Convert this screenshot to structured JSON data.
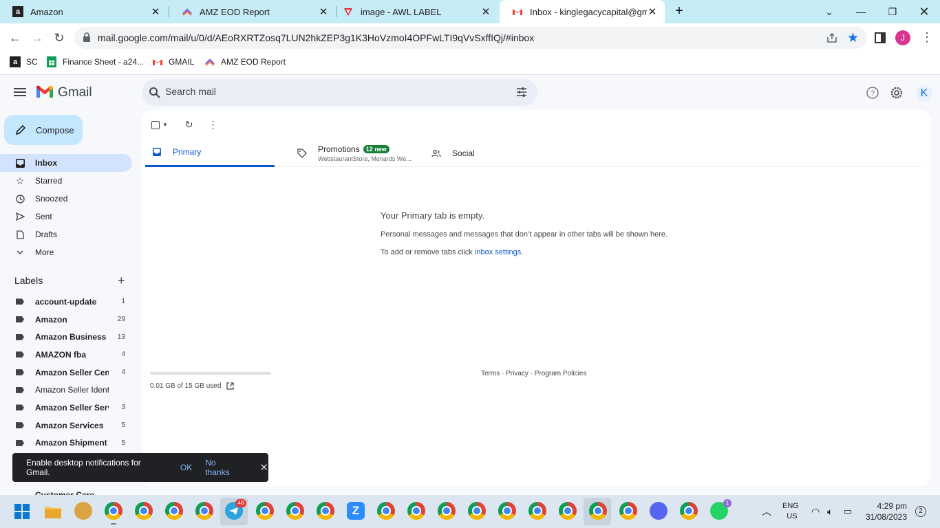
{
  "browser": {
    "tabs": [
      {
        "title": "Amazon",
        "icon": "amazon-icon"
      },
      {
        "title": "AMZ EOD Report",
        "icon": "clickup-icon"
      },
      {
        "title": "image - AWL LABEL",
        "icon": "airtable-icon"
      },
      {
        "title": "Inbox - kinglegacycapital@gmail",
        "icon": "gmail-icon"
      }
    ],
    "url": "mail.google.com/mail/u/0/d/AEoRXRTZosq7LUN2hkZEP3g1K3HoVzmoI4OPFwLTI9qVvSxffIQj/#inbox",
    "profile_initial": "J",
    "bookmarks": [
      {
        "label": "SC",
        "icon": "amazon-icon"
      },
      {
        "label": "Finance Sheet - a24...",
        "icon": "sheets-icon"
      },
      {
        "label": "GMAIL",
        "icon": "gmail-icon"
      },
      {
        "label": "AMZ EOD Report",
        "icon": "clickup-icon"
      }
    ]
  },
  "gmail": {
    "app_name": "Gmail",
    "search_placeholder": "Search mail",
    "account_initial": "K",
    "compose_label": "Compose",
    "nav": [
      {
        "label": "Inbox",
        "icon": "inbox-icon",
        "active": true
      },
      {
        "label": "Starred",
        "icon": "star-icon"
      },
      {
        "label": "Snoozed",
        "icon": "clock-icon"
      },
      {
        "label": "Sent",
        "icon": "send-icon"
      },
      {
        "label": "Drafts",
        "icon": "draft-icon"
      },
      {
        "label": "More",
        "icon": "chevron-down-icon"
      }
    ],
    "labels_heading": "Labels",
    "labels": [
      {
        "name": "account-update",
        "count": "1",
        "bold": true
      },
      {
        "name": "Amazon",
        "count": "29",
        "bold": true
      },
      {
        "name": "Amazon Business",
        "count": "13",
        "bold": true
      },
      {
        "name": "AMAZON fba",
        "count": "4",
        "bold": true
      },
      {
        "name": "Amazon Seller Cen...",
        "count": "4",
        "bold": true
      },
      {
        "name": "Amazon Seller Ident.",
        "count": "",
        "bold": false
      },
      {
        "name": "Amazon Seller Servi.",
        "count": "3",
        "bold": true
      },
      {
        "name": "Amazon Services",
        "count": "5",
        "bold": true
      },
      {
        "name": "Amazon Shipment",
        "count": "5",
        "bold": true
      }
    ],
    "cut_label": "Customer Care",
    "tabs": {
      "primary": "Primary",
      "promotions": "Promotions",
      "promotions_badge": "12 new",
      "promotions_senders": "WebstaurantStore, Menards We...",
      "social": "Social"
    },
    "empty": {
      "title": "Your Primary tab is empty.",
      "line1": "Personal messages and messages that don’t appear in other tabs will be shown here.",
      "line2_prefix": "To add or remove tabs click ",
      "line2_link": "inbox settings",
      "line2_suffix": "."
    },
    "storage": {
      "text": "0.01 GB of 15 GB used",
      "fraction": 0.0007
    },
    "footer": "Terms · Privacy · Program Policies",
    "toast": {
      "message": "Enable desktop notifications for Gmail.",
      "ok": "OK",
      "no": "No thanks"
    }
  },
  "taskbar": {
    "lang_top": "ENG",
    "lang_bottom": "US",
    "time": "4:29 pm",
    "date": "31/08/2023",
    "notif_count": "2",
    "telegram_badge": "48",
    "whatsapp_badge": "1"
  },
  "colors": {
    "tabstrip": "#c6ecf6",
    "compose": "#c2e7ff",
    "active_nav": "#d3e3fd",
    "primary_tab": "#0b57d0",
    "badge_green": "#188038"
  }
}
